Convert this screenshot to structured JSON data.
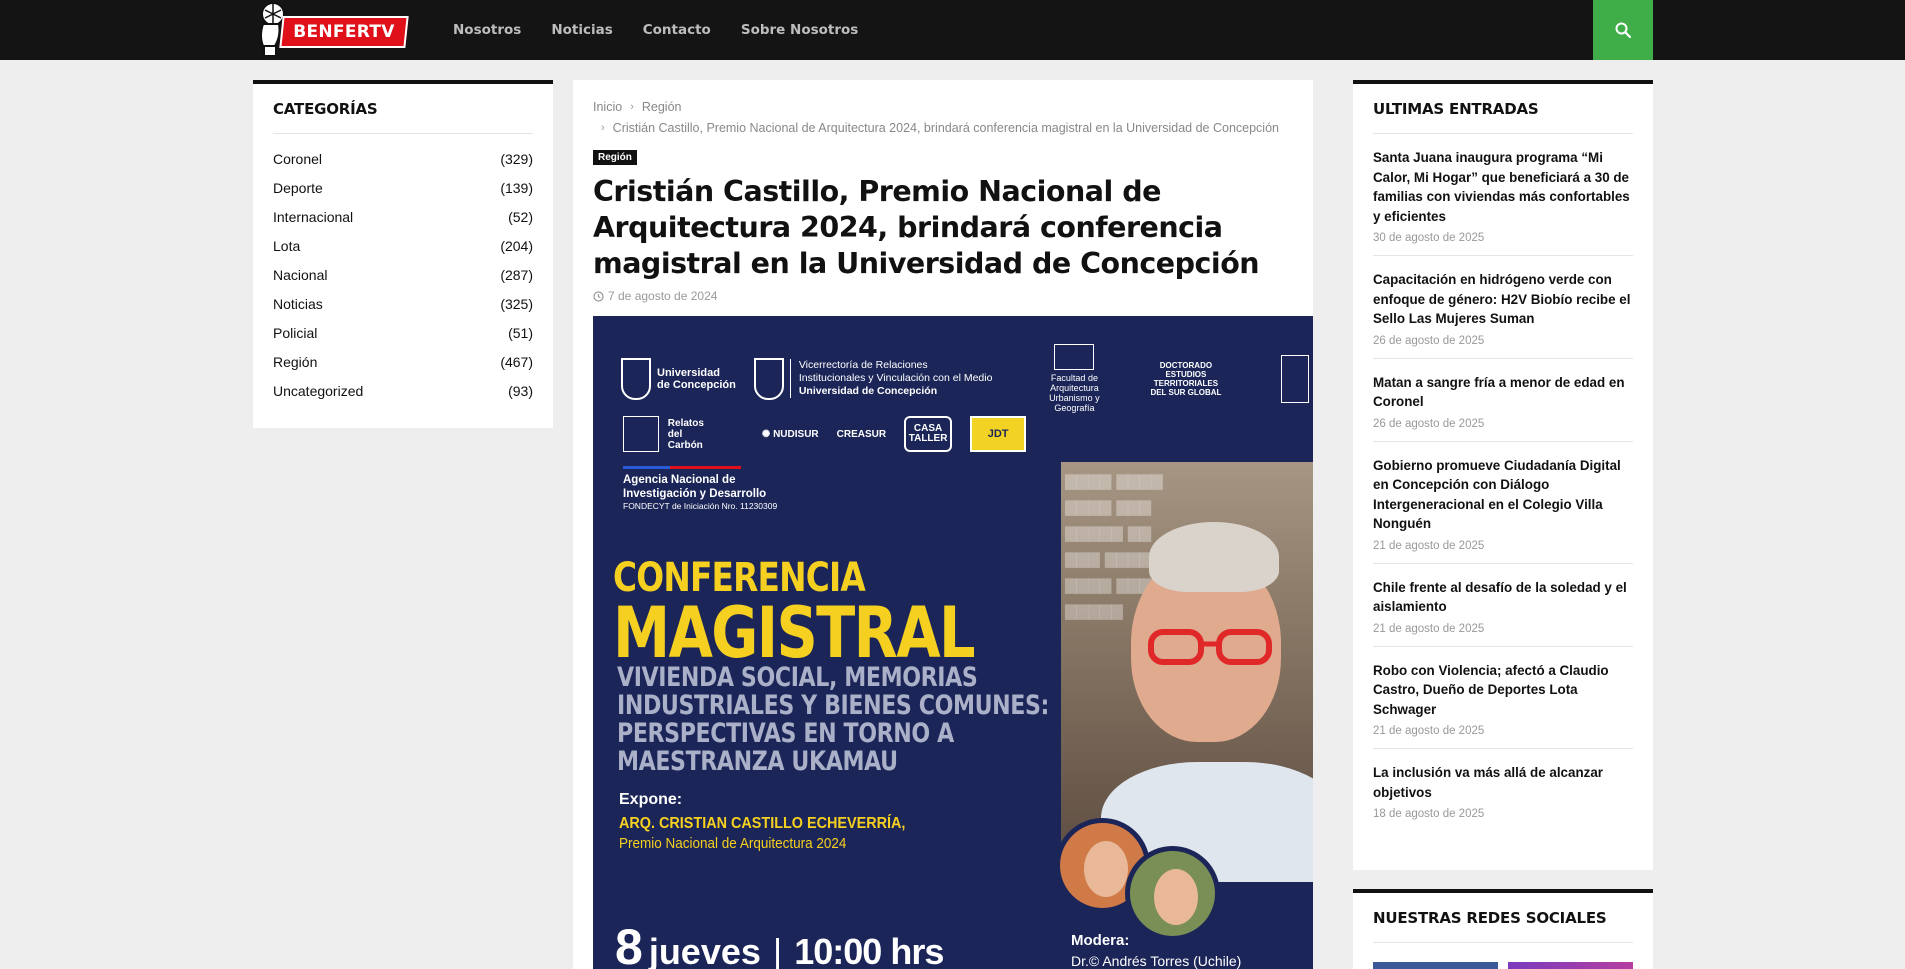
{
  "header": {
    "logo_text": "BENFERTV",
    "nav": [
      "Nosotros",
      "Noticias",
      "Contacto",
      "Sobre Nosotros"
    ],
    "search_icon": "search-icon"
  },
  "categories": {
    "title": "CATEGORÍAS",
    "items": [
      {
        "label": "Coronel",
        "count": "(329)"
      },
      {
        "label": "Deporte",
        "count": "(139)"
      },
      {
        "label": "Internacional",
        "count": "(52)"
      },
      {
        "label": "Lota",
        "count": "(204)"
      },
      {
        "label": "Nacional",
        "count": "(287)"
      },
      {
        "label": "Noticias",
        "count": "(325)"
      },
      {
        "label": "Policial",
        "count": "(51)"
      },
      {
        "label": "Región",
        "count": "(467)"
      },
      {
        "label": "Uncategorized",
        "count": "(93)"
      }
    ]
  },
  "article": {
    "breadcrumb": {
      "home": "Inicio",
      "section": "Región",
      "current": "Cristián Castillo, Premio Nacional de Arquitectura 2024, brindará conferencia magistral en la Universidad de Concepción"
    },
    "tag": "Región",
    "title": "Cristián Castillo, Premio Nacional de Arquitectura 2024, brindará conferencia magistral en la Universidad de Concepción",
    "date": "7 de agosto de 2024",
    "poster": {
      "uc_name_1": "Universidad",
      "uc_name_2": "de Concepción",
      "vr_1": "Vicerrectoría de Relaciones",
      "vr_2": "Institucionales y Vinculación con el Medio",
      "vr_3": "Universidad de Concepción",
      "faug": "Facultad de Arquitectura Urbanismo y Geografía",
      "doct_1": "DOCTORADO",
      "doct_2": "ESTUDIOS",
      "doct_3": "TERRITORIALES",
      "doct_4": "DEL SUR GLOBAL",
      "relatos_1": "Relatos",
      "relatos_2": "del",
      "relatos_3": "Carbón",
      "nudisur": "NUDISUR",
      "creasur": "CREASUR",
      "casa": "CASA TALLER",
      "jdt": "JDT",
      "anid_1": "Agencia Nacional de",
      "anid_2": "Investigación y Desarrollo",
      "anid_3": "FONDECYT de Iniciación Nro. 11230309",
      "conf_1": "CONFERENCIA",
      "conf_2": "MAGISTRAL",
      "subtitle_1": "VIVIENDA SOCIAL, MEMORIAS",
      "subtitle_2": "INDUSTRIALES Y BIENES COMUNES:",
      "subtitle_3": "PERSPECTIVAS EN TORNO A",
      "subtitle_4": "MAESTRANZA UKAMAU",
      "expone_label": "Expone:",
      "expone_name": "ARQ. CRISTIAN CASTILLO ECHEVERRÍA,",
      "expone_award": "Premio Nacional de Arquitectura 2024",
      "day": "8",
      "weekday": "jueves",
      "time": "10:00 hrs",
      "modera_label": "Modera:",
      "modera_name": "Dr.© Andrés Torres (Uchile)"
    }
  },
  "recent": {
    "title": "ULTIMAS ENTRADAS",
    "posts": [
      {
        "title": "Santa Juana inaugura programa “Mi Calor, Mi Hogar” que beneficiará a 30 de familias con viviendas más confortables y eficientes",
        "date": "30 de agosto de 2025"
      },
      {
        "title": "Capacitación en hidrógeno verde con enfoque de género: H2V Biobío recibe el Sello Las Mujeres Suman",
        "date": "26 de agosto de 2025"
      },
      {
        "title": "Matan a sangre fría a menor de edad en Coronel",
        "date": "26 de agosto de 2025"
      },
      {
        "title": "Gobierno promueve Ciudadanía Digital en Concepción con Diálogo Intergeneracional en el Colegio Villa Nonguén",
        "date": "21 de agosto de 2025"
      },
      {
        "title": "Chile frente al desafío de la soledad y el aislamiento",
        "date": "21 de agosto de 2025"
      },
      {
        "title": "Robo con Violencia; afectó a Claudio Castro, Dueño de Deportes Lota Schwager",
        "date": "21 de agosto de 2025"
      },
      {
        "title": "La inclusión va más allá de alcanzar objetivos",
        "date": "18 de agosto de 2025"
      }
    ]
  },
  "social": {
    "title": "NUESTRAS REDES SOCIALES"
  }
}
